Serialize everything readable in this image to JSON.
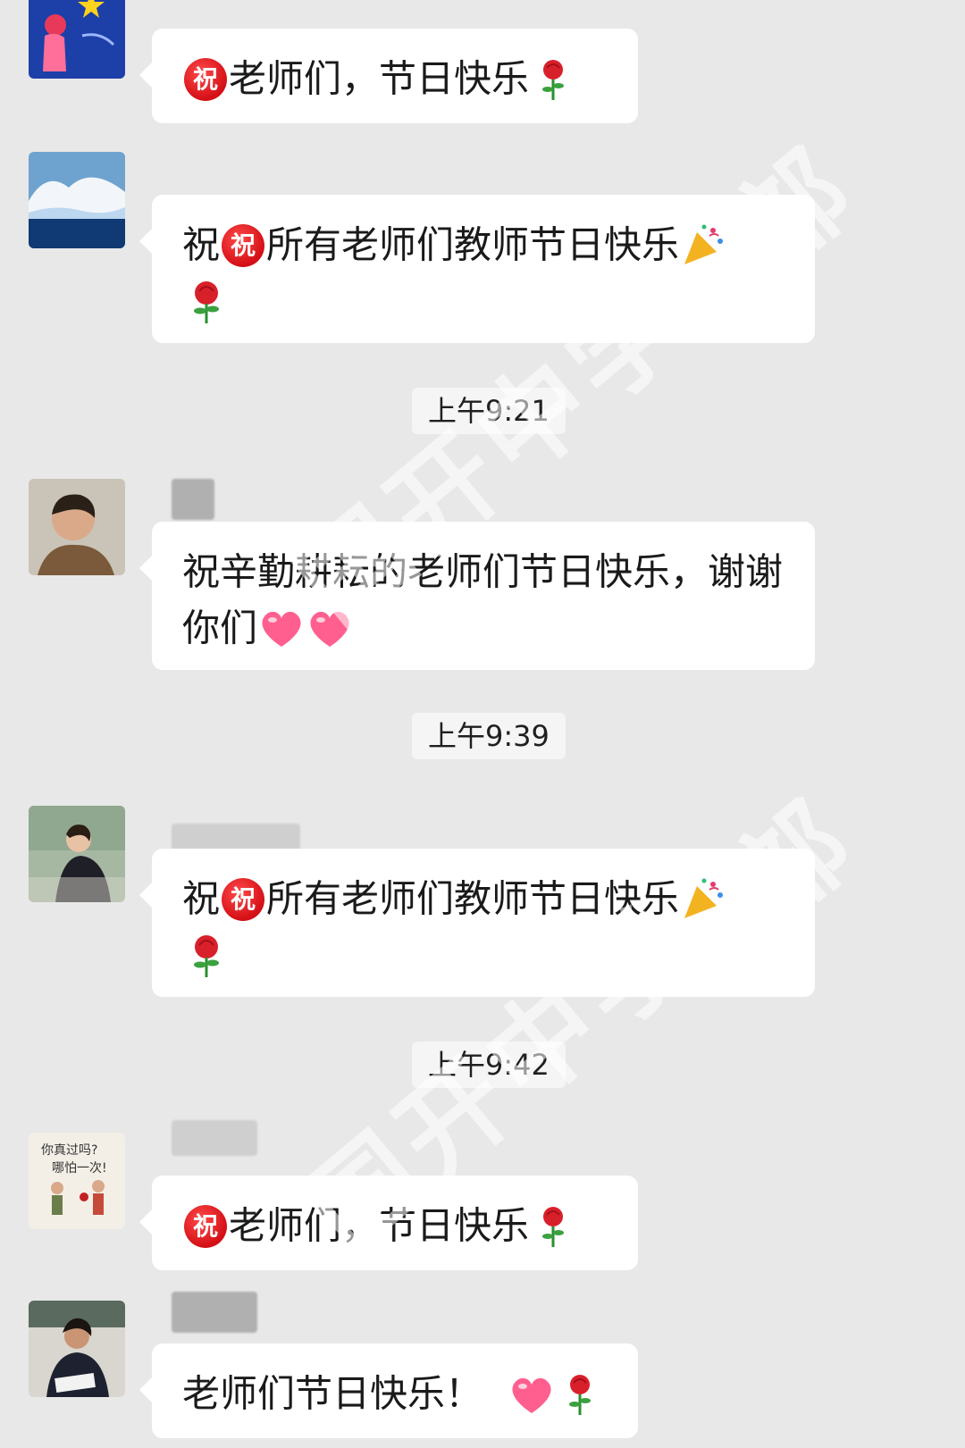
{
  "messages": [
    {
      "id": 1,
      "text_before": "",
      "badge": "祝",
      "text": "老师们，节日快乐",
      "emojis": [
        "rose"
      ]
    },
    {
      "id": 2,
      "text_before": "祝",
      "badge": "祝",
      "text": "所有老师们教师节日快乐",
      "emojis": [
        "party-popper",
        "rose"
      ]
    },
    {
      "id": 3,
      "text_before": "",
      "badge": "",
      "text": "祝辛勤耕耘的老师们节日快乐，谢谢你们",
      "emojis": [
        "heart",
        "heart"
      ]
    },
    {
      "id": 4,
      "text_before": "祝",
      "badge": "祝",
      "text": "所有老师们教师节日快乐",
      "emojis": [
        "party-popper",
        "rose"
      ]
    },
    {
      "id": 5,
      "text_before": "",
      "badge": "祝",
      "text": "老师们，节日快乐",
      "emojis": [
        "rose"
      ]
    },
    {
      "id": 6,
      "text_before": "",
      "badge": "",
      "text": "老师们节日快乐！",
      "emojis": [
        "heart",
        "rose"
      ]
    }
  ],
  "timestamps": [
    "上午9:21",
    "上午9:39",
    "上午9:42"
  ],
  "watermark": "国开中学",
  "watermark2": "部",
  "colors": {
    "background": "#e8e8e8",
    "bubble": "#ffffff",
    "badge": "#d40f16",
    "timestamp_bg": "#f5f5f5"
  }
}
